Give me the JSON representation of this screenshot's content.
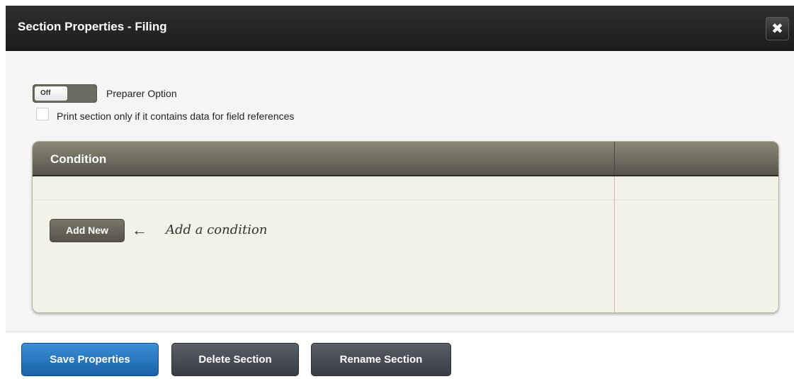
{
  "dialog": {
    "title": "Section Properties - Filing",
    "close_glyph": "✖"
  },
  "options": {
    "toggle_state": "Off",
    "toggle_label": "Preparer Option",
    "checkbox_label": "Print section only if it contains data for field references",
    "checkbox_checked": false
  },
  "condition_panel": {
    "header": "Condition",
    "add_button_label": "Add New",
    "hint_arrow": "←",
    "hint_text": "Add a condition"
  },
  "footer": {
    "save_label": "Save Properties",
    "delete_label": "Delete Section",
    "rename_label": "Rename Section"
  },
  "colors": {
    "title_bar": "#1c1c1c",
    "primary_button": "#1862a9",
    "secondary_button": "#383c43",
    "panel_background": "#f3f2e6"
  }
}
